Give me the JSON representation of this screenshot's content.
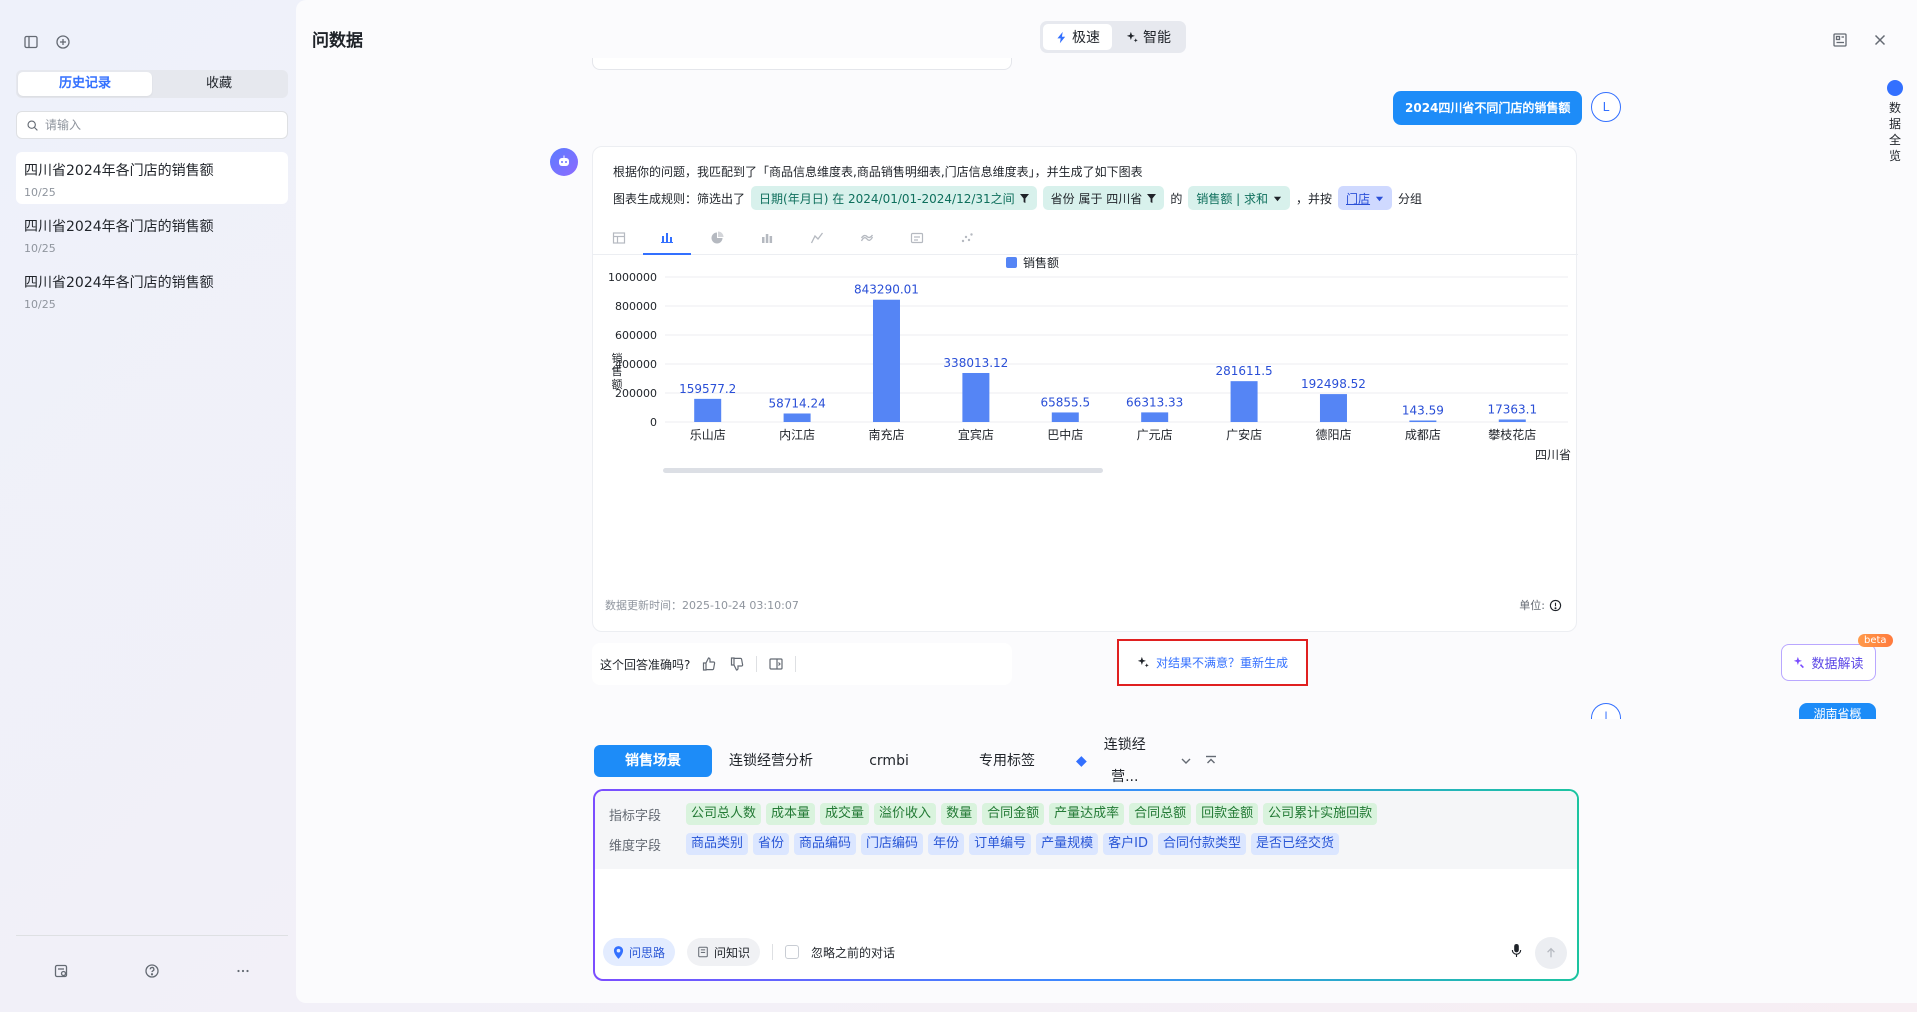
{
  "sidebar": {
    "tabs": [
      {
        "label": "历史记录"
      },
      {
        "label": "收藏"
      }
    ],
    "search_placeholder": "请输入",
    "history": [
      {
        "title": "四川省2024年各门店的销售额",
        "date": "10/25"
      },
      {
        "title": "四川省2024年各门店的销售额",
        "date": "10/25"
      },
      {
        "title": "四川省2024年各门店的销售额",
        "date": "10/25"
      }
    ]
  },
  "header": {
    "title": "问数据",
    "modes": [
      {
        "label": "极速"
      },
      {
        "label": "智能"
      }
    ]
  },
  "right_rail": {
    "label": "数据全览"
  },
  "conversation": {
    "user_question": "2024四川省不同门店的销售额",
    "user_avatar": "L",
    "intro": "根据你的问题，我匹配到了「商品信息维度表,商品销售明细表,门店信息维度表」，并生成了如下图表",
    "rule_prefix": "图表生成规则：筛选出了",
    "filter_date": "日期(年月日) 在 2024/01/01-2024/12/31之间",
    "filter_province": "省份 属于 四川省",
    "rule_of": "的",
    "measure": "销售额 | 求和",
    "rule_group_prefix": "，并按",
    "group_by": "门店",
    "rule_group_suffix": "分组",
    "update_time": "数据更新时间：2025-10-24 03:10:07",
    "unit_label": "单位:",
    "feedback_question": "这个回答准确吗?",
    "regenerate": "对结果不满意？重新生成",
    "interpret": "数据解读",
    "beta": "beta",
    "next_user_peek": "湖南省概"
  },
  "chart_data": {
    "type": "bar",
    "legend": "销售额",
    "ylabel": "销售额",
    "ylim": [
      0,
      1000000
    ],
    "yticks": [
      "1000000",
      "800000",
      "600000",
      "400000",
      "200000",
      "0"
    ],
    "categories": [
      "乐山店",
      "内江店",
      "南充店",
      "宜宾店",
      "巴中店",
      "广元店",
      "广安店",
      "德阳店",
      "成都店",
      "攀枝花店"
    ],
    "values": [
      159577.2,
      58714.24,
      843290.01,
      338013.12,
      65855.5,
      66313.33,
      281611.5,
      192498.52,
      143.59,
      17363.1
    ],
    "value_labels": [
      "159577.2",
      "58714.24",
      "843290.01",
      "338013.12",
      "65855.5",
      "66313.33",
      "281611.5",
      "192498.52",
      "143.59",
      "17363.1"
    ],
    "x_group_label": "四川省",
    "color": "#5585f5"
  },
  "scenes": {
    "tabs": [
      {
        "label": "销售场景"
      },
      {
        "label": "连锁经营分析"
      },
      {
        "label": "crmbi"
      },
      {
        "label": "专用标签"
      },
      {
        "label": "连锁经营..."
      }
    ]
  },
  "composer": {
    "metric_label": "指标字段",
    "metrics": [
      "公司总人数",
      "成本量",
      "成交量",
      "溢价收入",
      "数量",
      "合同金额",
      "产量达成率",
      "合同总额",
      "回款金额",
      "公司累计实施回款"
    ],
    "dimension_label": "维度字段",
    "dimensions": [
      "商品类别",
      "省份",
      "商品编码",
      "门店编码",
      "年份",
      "订单编号",
      "产量规模",
      "客户ID",
      "合同付款类型",
      "是否已经交货"
    ],
    "idea_pill": "问思路",
    "knowledge_pill": "问知识",
    "ignore_label": "忽略之前的对话"
  },
  "colors": {
    "accent": "#3370ff",
    "user_bubble": "#1d8cf8",
    "regen_border": "#e02020"
  }
}
